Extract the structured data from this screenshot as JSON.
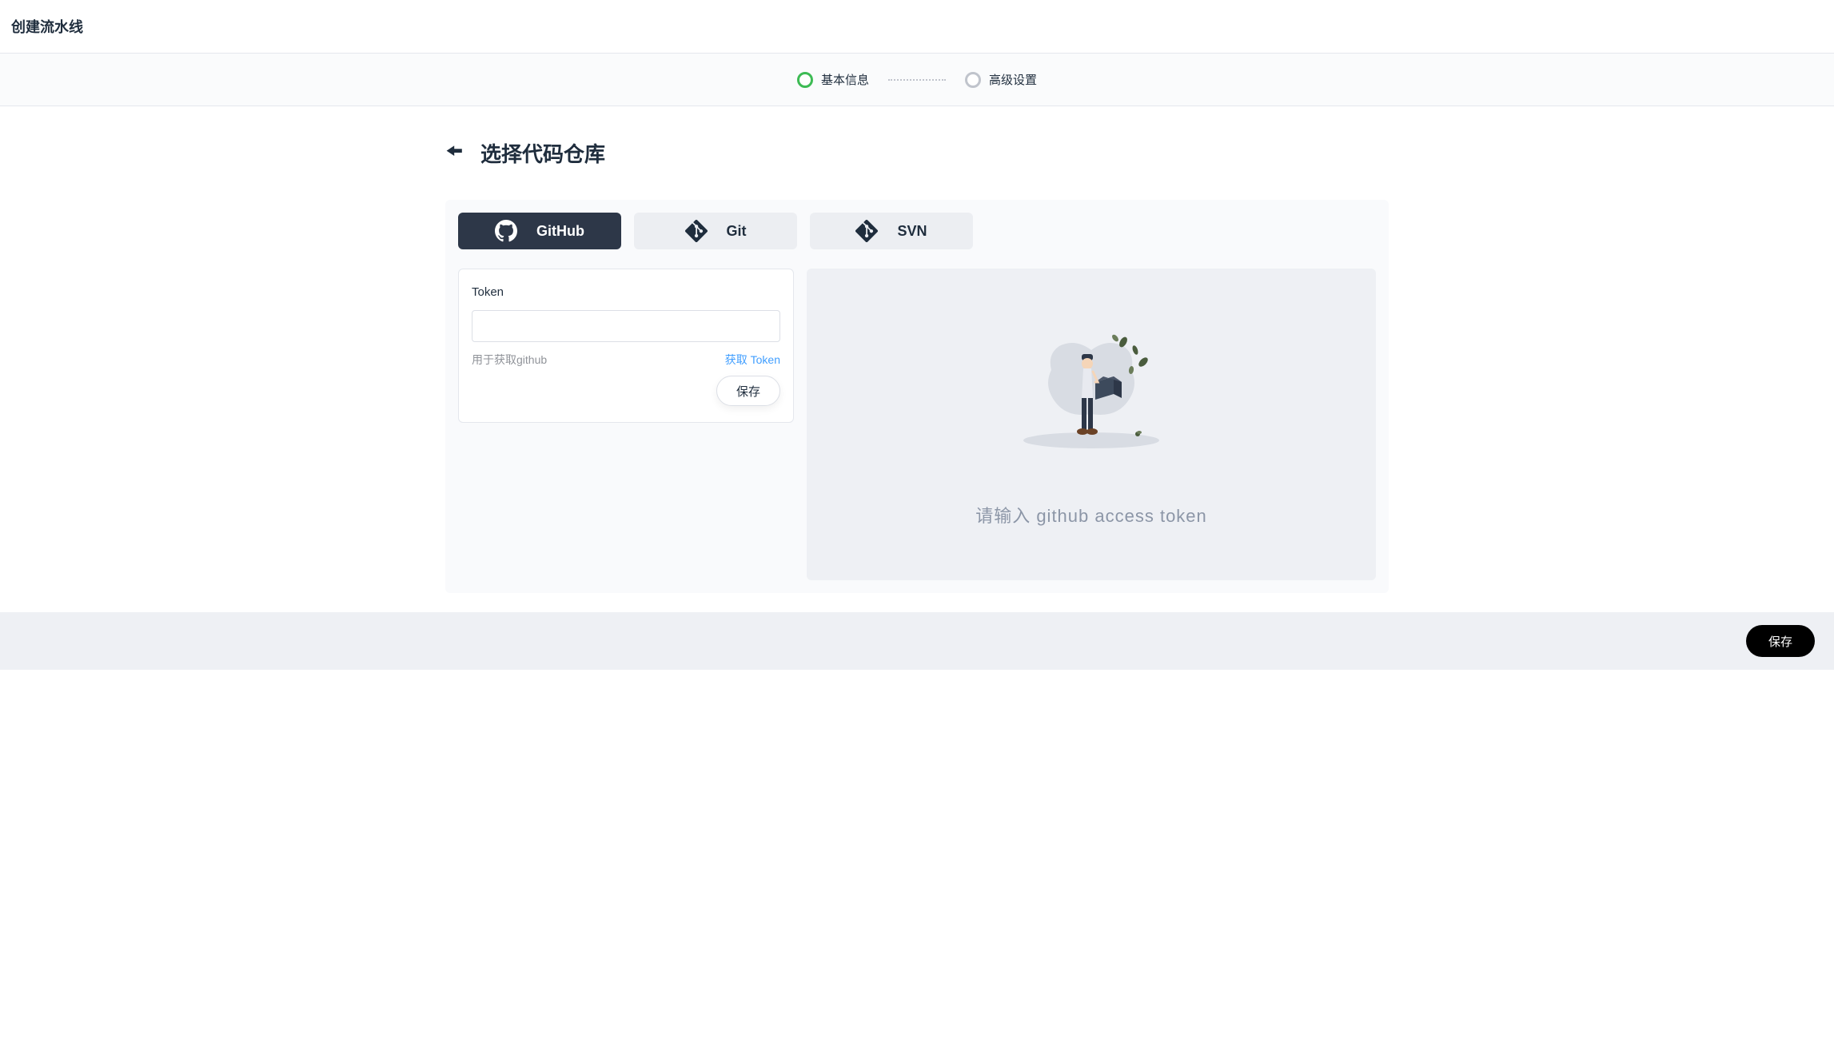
{
  "header": {
    "title": "创建流水线"
  },
  "steps": {
    "step1": "基本信息",
    "step2": "高级设置"
  },
  "section": {
    "title": "选择代码仓库"
  },
  "tabs": {
    "github": "GitHub",
    "git": "Git",
    "svn": "SVN"
  },
  "form": {
    "token_label": "Token",
    "help_text": "用于获取github",
    "get_token_link": "获取 Token",
    "save_button": "保存"
  },
  "empty": {
    "message": "请输入 github access token"
  },
  "footer": {
    "save_button": "保存"
  }
}
